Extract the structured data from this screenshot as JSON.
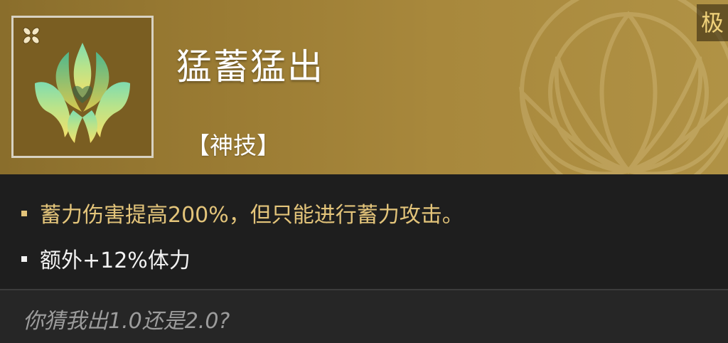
{
  "skill": {
    "name": "猛蓄猛出",
    "category": "【神技】",
    "tier": "极",
    "icon": "golden-lotus-flame-icon",
    "badge_icon": "four-petal-star-icon"
  },
  "effects": [
    {
      "text": "蓄力伤害提高200%，但只能进行蓄力攻击。",
      "color": "#e3c47a"
    },
    {
      "text": "额外+12%体力",
      "color": "#f2f2f2"
    }
  ],
  "flavor_text": "你猜我出1.0还是2.0?",
  "colors": {
    "header_gold": "#a8883c",
    "effect_gold": "#e3c47a",
    "panel_dark": "#1e1e1e",
    "flavor_gray": "#9c9c9c"
  }
}
